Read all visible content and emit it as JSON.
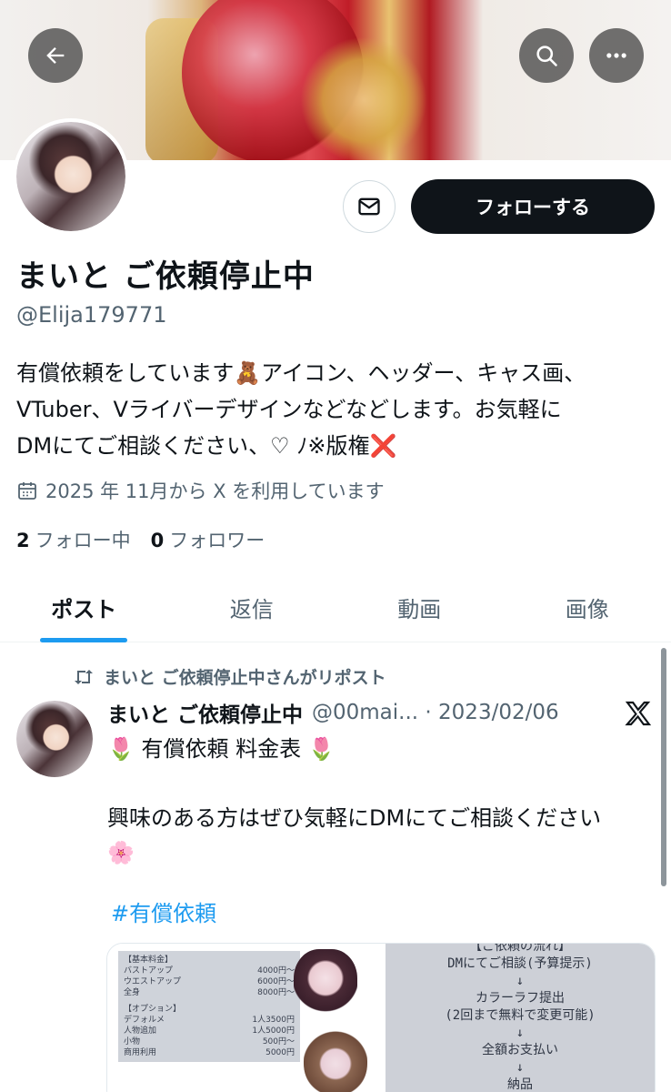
{
  "profile": {
    "name": "まいと ご依頼停止中",
    "handle": "@Elija179771",
    "bio_line1": "有償依頼をしています🧸アイコン、ヘッダー、キャス画、",
    "bio_line2": "VTuber、Vライバーデザインなどなどします。お気軽に",
    "bio_line3": "DMにてご相談ください、♡ ﾉ※版権❌",
    "joined": "2025 年 11月から X を利用しています",
    "following_count": "2",
    "following_label": "フォロー中",
    "followers_count": "0",
    "followers_label": "フォロワー",
    "follow_button": "フォローする"
  },
  "tabs": [
    "ポスト",
    "返信",
    "動画",
    "画像"
  ],
  "post": {
    "repost_label": "まいと ご依頼停止中さんがリポスト",
    "author_name": "まいと ご依頼停止中",
    "meta": "@00mai... · 2023/02/06",
    "line1": "🌷 有償依頼 料金表 🌷",
    "line2": "興味のある方はぜひ気軽にDMにてご相談ください",
    "line3": "🌸",
    "hashtag": "#有償依頼"
  },
  "media": {
    "price_title": "【基本料金】",
    "prices": [
      {
        "item": "バストアップ",
        "price": "4000円〜"
      },
      {
        "item": "ウエストアップ",
        "price": "6000円〜"
      },
      {
        "item": "全身",
        "price": "8000円〜"
      }
    ],
    "option_title": "【オプション】",
    "options": [
      {
        "item": "デフォルメ",
        "price": "1人3500円"
      },
      {
        "item": "人物追加",
        "price": "1人5000円"
      },
      {
        "item": "小物",
        "price": "500円〜"
      },
      {
        "item": "商用利用",
        "price": "5000円"
      }
    ],
    "flow_title": "【ご依頼の流れ】",
    "flow": [
      "DMにてご相談(予算提示)",
      "↓",
      "カラーラフ提出",
      "(2回まで無料で変更可能)",
      "↓",
      "全額お支払い",
      "↓",
      "納品"
    ]
  },
  "colors": {
    "accent": "#1d9bf0",
    "text": "#0f1419",
    "muted": "#536471"
  }
}
